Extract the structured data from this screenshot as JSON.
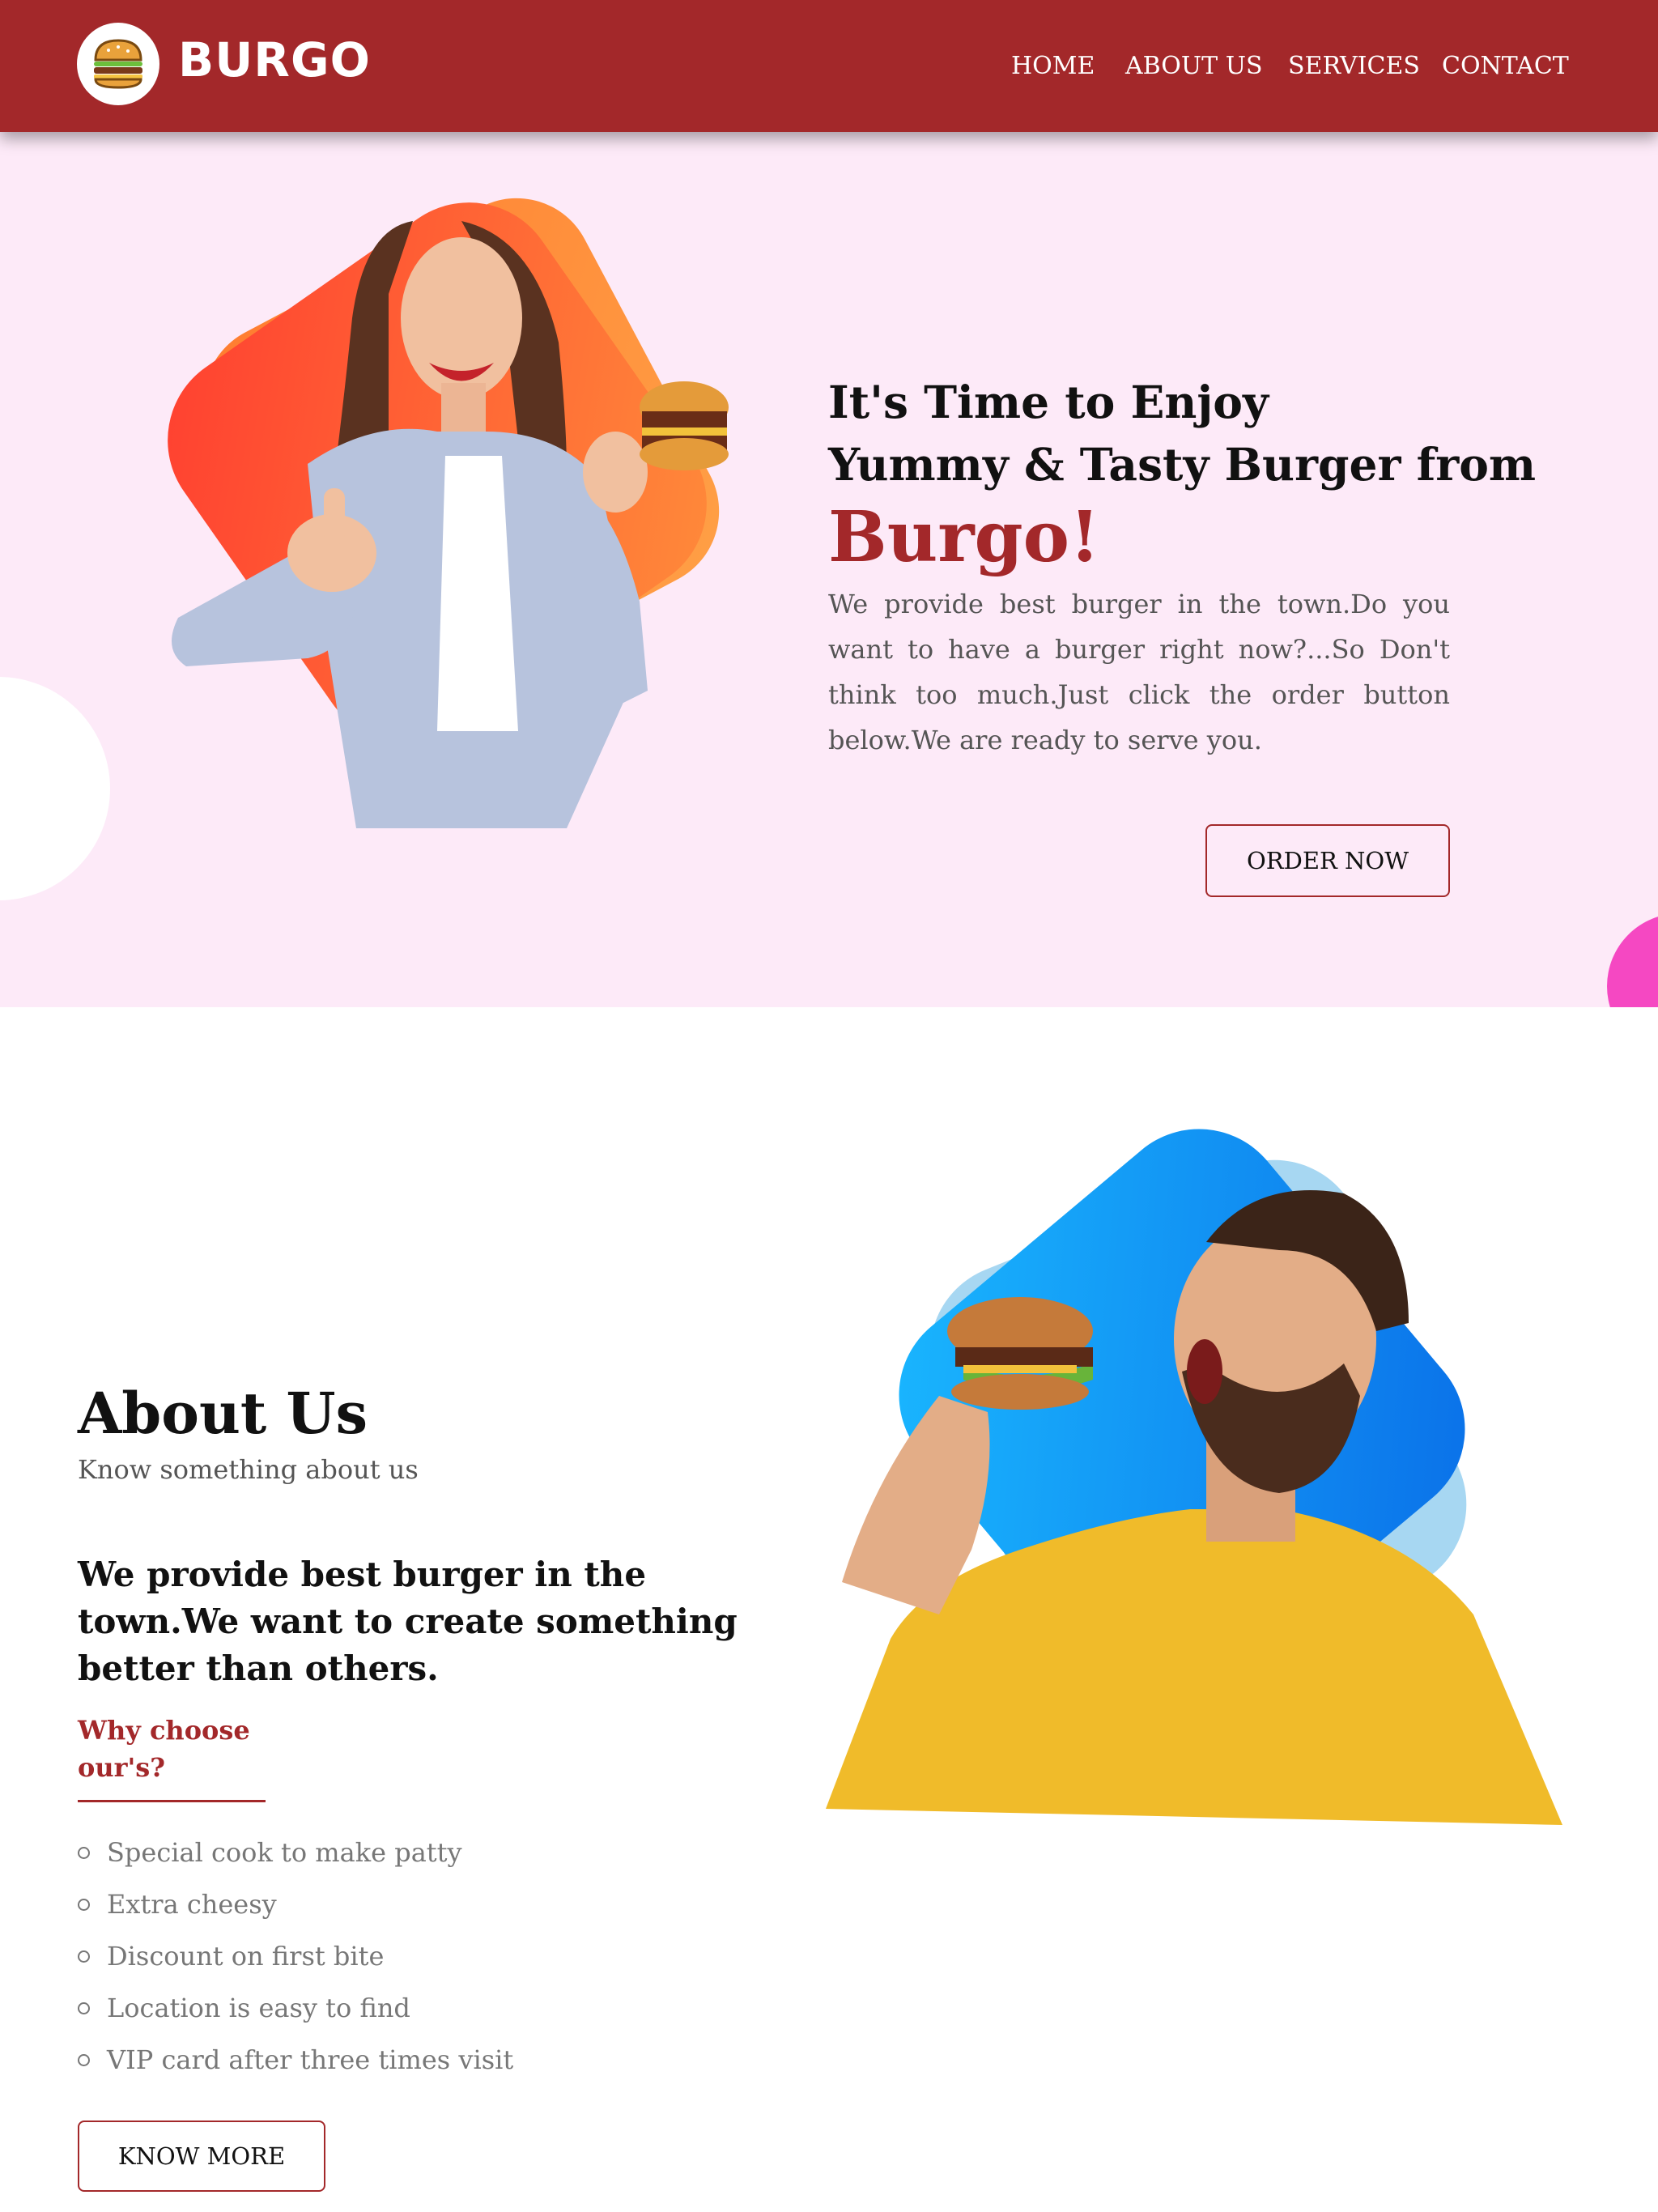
{
  "header": {
    "brand": "BURGO",
    "nav": [
      "HOME",
      "ABOUT US",
      "SERVICES",
      "CONTACT"
    ]
  },
  "hero": {
    "title_line1": "It's Time to Enjoy",
    "title_line2": "Yummy & Tasty Burger from",
    "brand": "Burgo!",
    "description": "We provide best burger in the town.Do you want to have a burger right now?...So Don't think too much.Just click the order button below.We are ready to serve you.",
    "cta": "ORDER NOW"
  },
  "about": {
    "title": "About Us",
    "subtitle": "Know something about us",
    "lead": "We provide best burger in the town.We want to create something better than others.",
    "why": "Why choose our's?",
    "features": [
      "Special cook to make patty",
      "Extra cheesy",
      "Discount on first bite",
      "Location is easy to find",
      "VIP card after three times visit"
    ],
    "cta": "KNOW MORE"
  },
  "colors": {
    "brand_red": "#a3282a",
    "hero_bg": "#fdeaf8",
    "hero_shape_orange": "#ff5a2e",
    "about_shape_blue": "#0c8ff2"
  }
}
